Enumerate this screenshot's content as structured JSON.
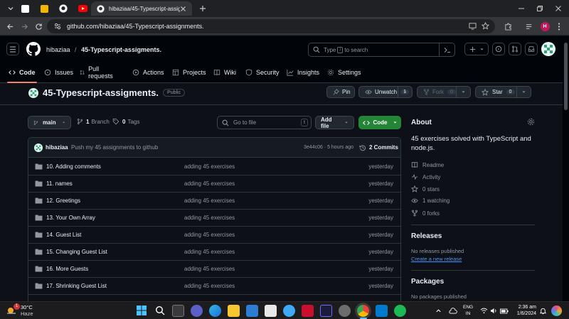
{
  "browser": {
    "active_tab_title": "hibaziaa/45-Typescript-assigm",
    "url": "github.com/hibaziaa/45-Typescript-assignments.",
    "profile_initial": "H"
  },
  "header": {
    "owner": "hibaziaa",
    "separator": "/",
    "repo": "45-Typescript-assigments.",
    "search_pre": "Type",
    "search_key": "/",
    "search_post": "to search"
  },
  "repo_nav": [
    {
      "label": "Code",
      "icon": "code-icon"
    },
    {
      "label": "Issues",
      "icon": "issue-icon"
    },
    {
      "label": "Pull requests",
      "icon": "pull-request-icon"
    },
    {
      "label": "Actions",
      "icon": "play-icon"
    },
    {
      "label": "Projects",
      "icon": "table-icon"
    },
    {
      "label": "Wiki",
      "icon": "book-icon"
    },
    {
      "label": "Security",
      "icon": "shield-icon"
    },
    {
      "label": "Insights",
      "icon": "graph-icon"
    },
    {
      "label": "Settings",
      "icon": "gear-icon"
    }
  ],
  "repo": {
    "name": "45-Typescript-assigments.",
    "visibility": "Public",
    "pin_label": "Pin",
    "unwatch_label": "Unwatch",
    "unwatch_count": "1",
    "fork_label": "Fork",
    "fork_count": "0",
    "star_label": "Star",
    "star_count": "0"
  },
  "toolbar": {
    "branch": "main",
    "branch_count": "1",
    "branch_label": "Branch",
    "tag_count": "0",
    "tag_label": "Tags",
    "goto_placeholder": "Go to file",
    "goto_key": "t",
    "add_file": "Add file",
    "code": "Code"
  },
  "commit": {
    "author": "hibaziaa",
    "message": "Push my 45 assignments to github",
    "hash_time": "3e44c06 · 5 hours ago",
    "commits_label": "2 Commits"
  },
  "files": [
    {
      "name": "10. Adding comments",
      "message": "adding 45 exercises",
      "date": "yesterday"
    },
    {
      "name": "11. names",
      "message": "adding 45 exercises",
      "date": "yesterday"
    },
    {
      "name": "12. Greetings",
      "message": "adding 45 exercises",
      "date": "yesterday"
    },
    {
      "name": "13. Your Own Array",
      "message": "adding 45 exercises",
      "date": "yesterday"
    },
    {
      "name": "14. Guest List",
      "message": "adding 45 exercises",
      "date": "yesterday"
    },
    {
      "name": "15. Changing Guest List",
      "message": "adding 45 exercises",
      "date": "yesterday"
    },
    {
      "name": "16. More Guests",
      "message": "adding 45 exercises",
      "date": "yesterday"
    },
    {
      "name": "17. Shrinking Guest List",
      "message": "adding 45 exercises",
      "date": "yesterday"
    },
    {
      "name": "",
      "message": "",
      "date": ""
    }
  ],
  "about": {
    "heading": "About",
    "description_line1": "45 exercises solved with TypeScript and",
    "description_line2": "node.js.",
    "readme": "Readme",
    "activity": "Activity",
    "stars": "0 stars",
    "watching": "1 watching",
    "forks": "0 forks"
  },
  "releases": {
    "heading": "Releases",
    "empty": "No releases published",
    "create_link": "Create a new release"
  },
  "packages": {
    "heading": "Packages",
    "empty": "No packages published"
  },
  "taskbar": {
    "temp": "30°C",
    "weather": "Haze",
    "badge": "1",
    "lang1": "ENG",
    "lang2": "IN",
    "time": "2:36 am",
    "date": "1/6/2024"
  },
  "colors": {
    "bg": "#0d1117",
    "header_bg": "#010409",
    "accent_green": "#238636",
    "link_blue": "#4493f8",
    "nav_underline": "#f78166"
  }
}
